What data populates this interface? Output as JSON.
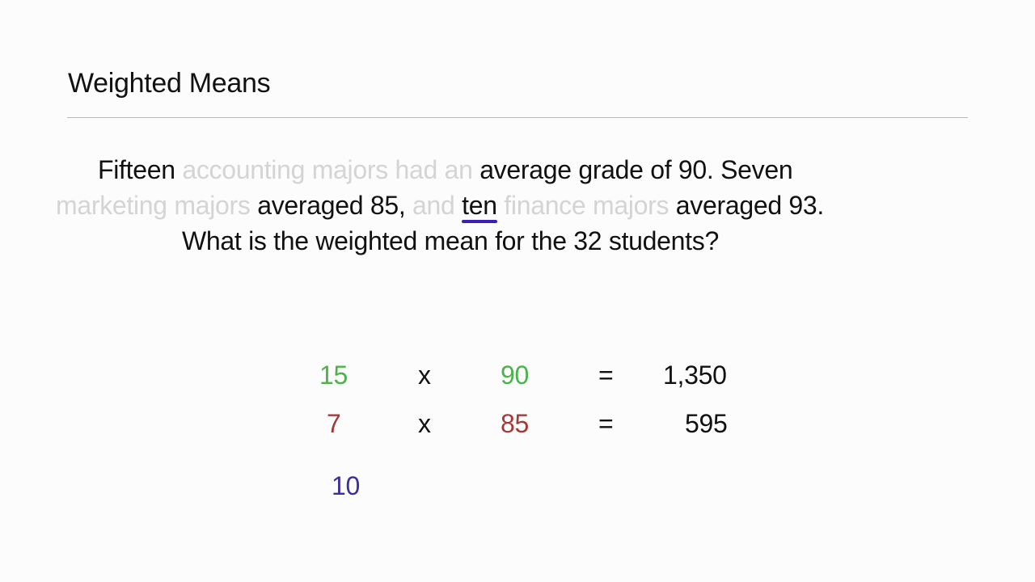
{
  "slide": {
    "title": "Weighted Means"
  },
  "problem": {
    "line1": [
      {
        "text": "Fifteen ",
        "style": "dark"
      },
      {
        "text": "accounting majors had an ",
        "style": "dim"
      },
      {
        "text": "average grade of 90. Seven",
        "style": "dark"
      }
    ],
    "line2": [
      {
        "text": "marketing majors ",
        "style": "dim"
      },
      {
        "text": "averaged 85, ",
        "style": "dark"
      },
      {
        "text": "and ",
        "style": "dim"
      },
      {
        "text": "ten",
        "style": "dark",
        "annotation": "underline"
      },
      {
        "text": " finance majors ",
        "style": "dim"
      },
      {
        "text": "averaged 93.",
        "style": "dark"
      }
    ],
    "line3": "What is the weighted mean for the 32 students?"
  },
  "calculation": {
    "rows": [
      {
        "count": "15",
        "times": "x",
        "grade": "90",
        "equals": "=",
        "product": "1,350",
        "color": "green"
      },
      {
        "count": "7",
        "times": "x",
        "grade": "85",
        "equals": "=",
        "product": "595",
        "color": "red"
      },
      {
        "count": "10",
        "times": "",
        "grade": "",
        "equals": "",
        "product": "",
        "color": "blue"
      }
    ]
  },
  "colors": {
    "green": "#4cb34a",
    "red": "#a33a3a",
    "blue": "#3a2e9e",
    "dim_text": "#d4d4d4",
    "underline": "#3b1fb8"
  }
}
